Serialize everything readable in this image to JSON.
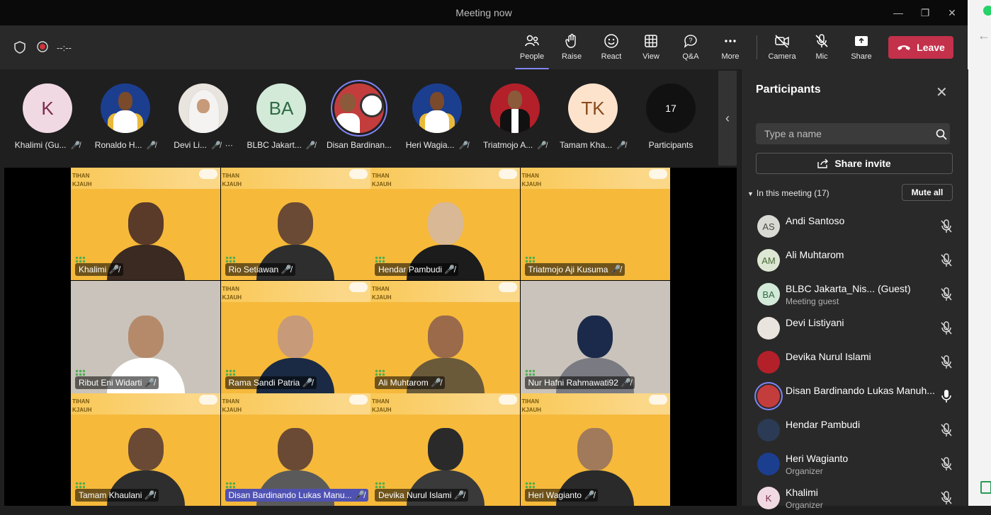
{
  "window": {
    "title": "Meeting now"
  },
  "toolbar": {
    "timer": "--:--",
    "buttons": [
      {
        "label": "People",
        "icon": "people-icon",
        "active": true
      },
      {
        "label": "Raise",
        "icon": "hand-icon"
      },
      {
        "label": "React",
        "icon": "smiley-icon"
      },
      {
        "label": "View",
        "icon": "grid-icon"
      },
      {
        "label": "Q&A",
        "icon": "qa-icon"
      },
      {
        "label": "More",
        "icon": "more-icon"
      },
      {
        "label": "Camera",
        "icon": "camera-off-icon"
      },
      {
        "label": "Mic",
        "icon": "mic-off-icon"
      },
      {
        "label": "Share",
        "icon": "share-icon"
      }
    ],
    "leave": "Leave"
  },
  "strip": {
    "tiles": [
      {
        "initials": "K",
        "name": "Khalimi (Gu...",
        "bg": "#f1d9e3",
        "fg": "#7a2b4c"
      },
      {
        "initials": "",
        "name": "Ronaldo H...",
        "bg": "#1b3e8f",
        "fg": "#fff"
      },
      {
        "initials": "",
        "name": "Devi Li...",
        "bg": "#e9e4de",
        "fg": "#333"
      },
      {
        "initials": "BA",
        "name": "BLBC Jakart...",
        "bg": "#d3ead9",
        "fg": "#2f6b44"
      },
      {
        "initials": "",
        "name": "Disan Bardinan...",
        "bg": "#c43d3d",
        "fg": "#fff"
      },
      {
        "initials": "",
        "name": "Heri Wagia...",
        "bg": "#1b3e8f",
        "fg": "#fff"
      },
      {
        "initials": "",
        "name": "Triatmojo A...",
        "bg": "#b3202a",
        "fg": "#fff"
      },
      {
        "initials": "TK",
        "name": "Tamam Kha...",
        "bg": "#fde3cc",
        "fg": "#8a4b1c"
      }
    ],
    "count": "17",
    "count_label": "Participants"
  },
  "grid": {
    "cells": [
      {
        "name": "Khalimi"
      },
      {
        "name": "Rio Setiawan"
      },
      {
        "name": "Hendar Pambudi"
      },
      {
        "name": "Triatmojo Aji Kusuma"
      },
      {
        "name": "Ribut Eni Widarti"
      },
      {
        "name": "Rama Sandi Patria"
      },
      {
        "name": "Ali Muhtarom"
      },
      {
        "name": "Nur Hafni Rahmawati92"
      },
      {
        "name": "Tamam Khaulani"
      },
      {
        "name": "Disan Bardinando Lukas Manu..."
      },
      {
        "name": "Devika Nurul Islami"
      },
      {
        "name": "Heri Wagianto"
      }
    ],
    "banner_line1": "TIHAN",
    "banner_line2": "KJAUH"
  },
  "panel": {
    "title": "Participants",
    "search_placeholder": "Type a name",
    "share_invite": "Share invite",
    "section_label": "In this meeting (17)",
    "mute_all": "Mute all",
    "participants": [
      {
        "initials": "AS",
        "name": "Andi Santoso",
        "sub": "",
        "bg": "#d9d9d4",
        "fg": "#4a4a44"
      },
      {
        "initials": "AM",
        "name": "Ali Muhtarom",
        "sub": "",
        "bg": "#dde7d3",
        "fg": "#4a6a33"
      },
      {
        "initials": "BA",
        "name": "BLBC Jakarta_Nis... (Guest)",
        "sub": "Meeting guest",
        "bg": "#d3ead9",
        "fg": "#2f6b44"
      },
      {
        "initials": "",
        "name": "Devi Listiyani",
        "sub": "",
        "bg": "#e9e4de",
        "fg": "#333"
      },
      {
        "initials": "",
        "name": "Devika Nurul Islami",
        "sub": "",
        "bg": "#b3202a",
        "fg": "#fff"
      },
      {
        "initials": "",
        "name": "Disan Bardinando Lukas Manuh...",
        "sub": "",
        "bg": "#c43d3d",
        "fg": "#fff"
      },
      {
        "initials": "",
        "name": "Hendar Pambudi",
        "sub": "",
        "bg": "#2b3b55",
        "fg": "#fff"
      },
      {
        "initials": "",
        "name": "Heri Wagianto",
        "sub": "Organizer",
        "bg": "#1b3e8f",
        "fg": "#fff"
      },
      {
        "initials": "K",
        "name": "Khalimi",
        "sub": "Organizer",
        "bg": "#f1d9e3",
        "fg": "#7a2b4c"
      }
    ]
  }
}
